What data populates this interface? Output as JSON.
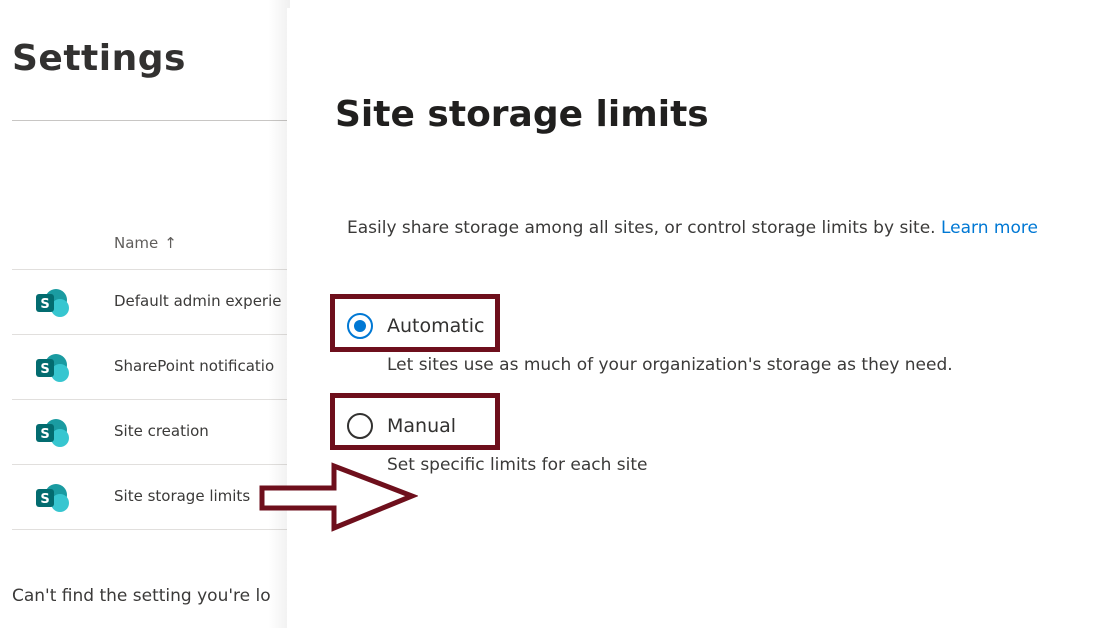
{
  "settings_page": {
    "title": "Settings",
    "column_header": "Name",
    "sort_arrow": "↑",
    "rows": [
      {
        "label": "Default admin experie",
        "icon": "sharepoint-icon"
      },
      {
        "label": "SharePoint notificatio",
        "icon": "sharepoint-icon"
      },
      {
        "label": "Site creation",
        "icon": "sharepoint-icon"
      },
      {
        "label": "Site storage limits",
        "icon": "sharepoint-icon"
      }
    ],
    "footer_text": "Can't find the setting you're lo"
  },
  "panel": {
    "title": "Site storage limits",
    "description": "Easily share storage among all sites, or control storage limits by site.",
    "learn_more": "Learn more",
    "options": [
      {
        "label": "Automatic",
        "help": "Let sites use as much of your organization's storage as they need.",
        "checked": true
      },
      {
        "label": "Manual",
        "help": "Set specific limits for each site",
        "checked": false
      }
    ]
  },
  "colors": {
    "accent": "#0078d4",
    "annotation": "#6e0f1c",
    "sharepoint_dark": "#036c70",
    "sharepoint_light": "#37c6d0"
  }
}
